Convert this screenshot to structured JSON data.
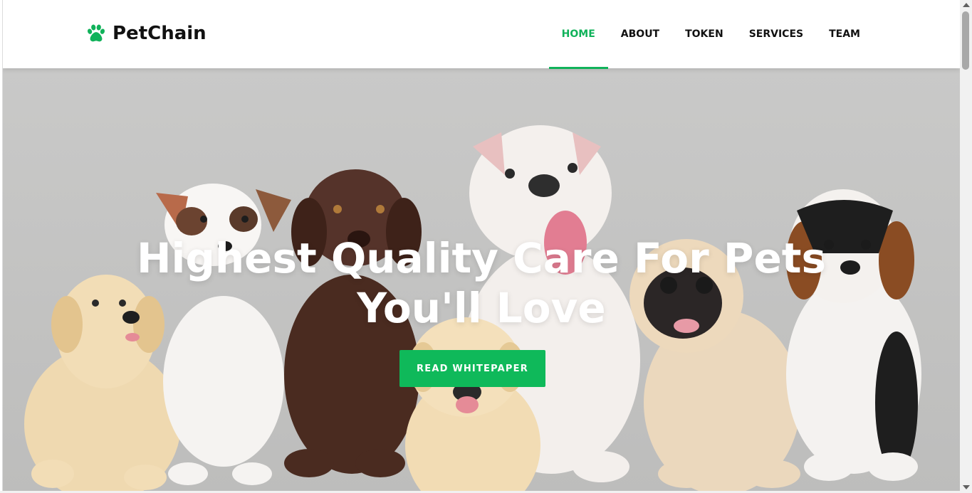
{
  "brand": {
    "name": "PetChain",
    "icon": "paw-icon",
    "accent_color": "#10b25a"
  },
  "nav": {
    "items": [
      {
        "label": "HOME",
        "active": true
      },
      {
        "label": "ABOUT",
        "active": false
      },
      {
        "label": "TOKEN",
        "active": false
      },
      {
        "label": "SERVICES",
        "active": false
      },
      {
        "label": "TEAM",
        "active": false
      }
    ]
  },
  "hero": {
    "title_line1": "Highest Quality Care For Pets",
    "title_line2": "You'll Love",
    "cta_label": "READ WHITEPAPER",
    "cta_color": "#0fb95a",
    "background_color": "#c9c9c8"
  }
}
